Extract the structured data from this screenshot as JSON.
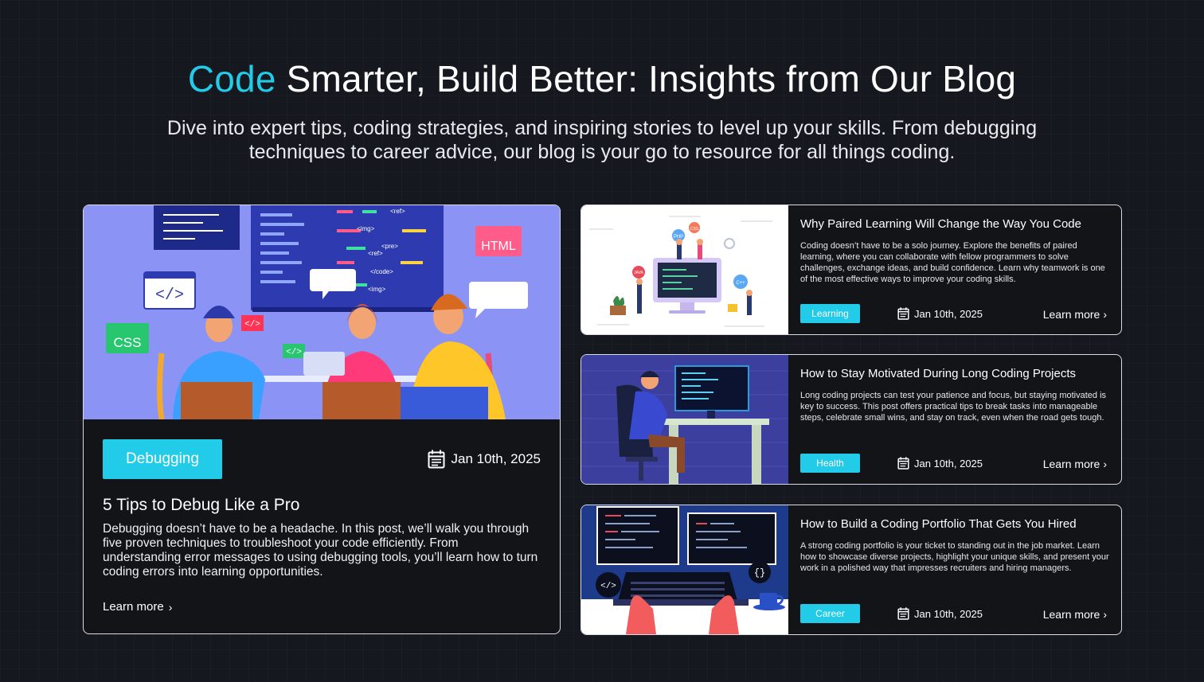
{
  "hero": {
    "title_accent": "Code",
    "title_rest": " Smarter, Build Better: Insights from Our Blog",
    "subtitle": "Dive into expert tips, coding strategies, and inspiring stories to level up your skills. From debugging techniques to career advice, our blog is your go to resource for all things coding."
  },
  "featured": {
    "illustration_labels": [
      "</>",
      "CSS",
      "HTML",
      "</>",
      "</>",
      "<ref>",
      "<img>",
      "<pre>",
      "<ref>",
      "</code>",
      "<img>"
    ],
    "tag": "Debugging",
    "date": "Jan 10th, 2025",
    "title": "5 Tips to Debug Like a Pro",
    "description": "Debugging doesn’t have to be a headache. In this post, we’ll walk you through five proven techniques to troubleshoot your code efficiently. From understanding error messages to using debugging tools, you’ll learn how to turn coding errors into learning opportunities.",
    "learn_more": "Learn more",
    "chevron": "›"
  },
  "posts": [
    {
      "title": "Why Paired Learning Will Change the Way You Code",
      "description": "Coding doesn’t have to be a solo journey. Explore the benefits of paired learning, where you can collaborate with fellow programmers to solve challenges, exchange ideas, and build confidence. Learn why teamwork is one of the most effective ways to improve your coding skills.",
      "tag": "Learning",
      "date": "Jan 10th, 2025",
      "learn_more": "Learn more",
      "chevron": "›",
      "thumb_labels": [
        "PHP",
        "CSS",
        "JAVA",
        "C++"
      ]
    },
    {
      "title": "How to Stay Motivated During Long Coding Projects",
      "description": "Long coding projects can test your patience and focus, but staying motivated is key to success. This post offers practical tips to break tasks into manageable steps, celebrate small wins, and stay on track, even when the road gets tough.",
      "tag": "Health",
      "date": "Jan 10th, 2025",
      "learn_more": "Learn more",
      "chevron": "›"
    },
    {
      "title": "How to Build a Coding Portfolio That Gets You Hired",
      "description": "A strong coding portfolio is your ticket to standing out in the job market. Learn how to showcase diverse projects, highlight your unique skills, and present your work in a polished way that impresses recruiters and hiring managers.",
      "tag": "Career",
      "date": "Jan 10th, 2025",
      "learn_more": "Learn more",
      "chevron": "›",
      "thumb_labels": [
        "</>",
        "{}"
      ]
    }
  ],
  "colors": {
    "accent": "#22cbe8",
    "background": "#15181e",
    "card": "#121418",
    "border": "#d9dde3"
  },
  "icons": {
    "date": "calendar-icon",
    "learn_more": "chevron-right-icon"
  }
}
